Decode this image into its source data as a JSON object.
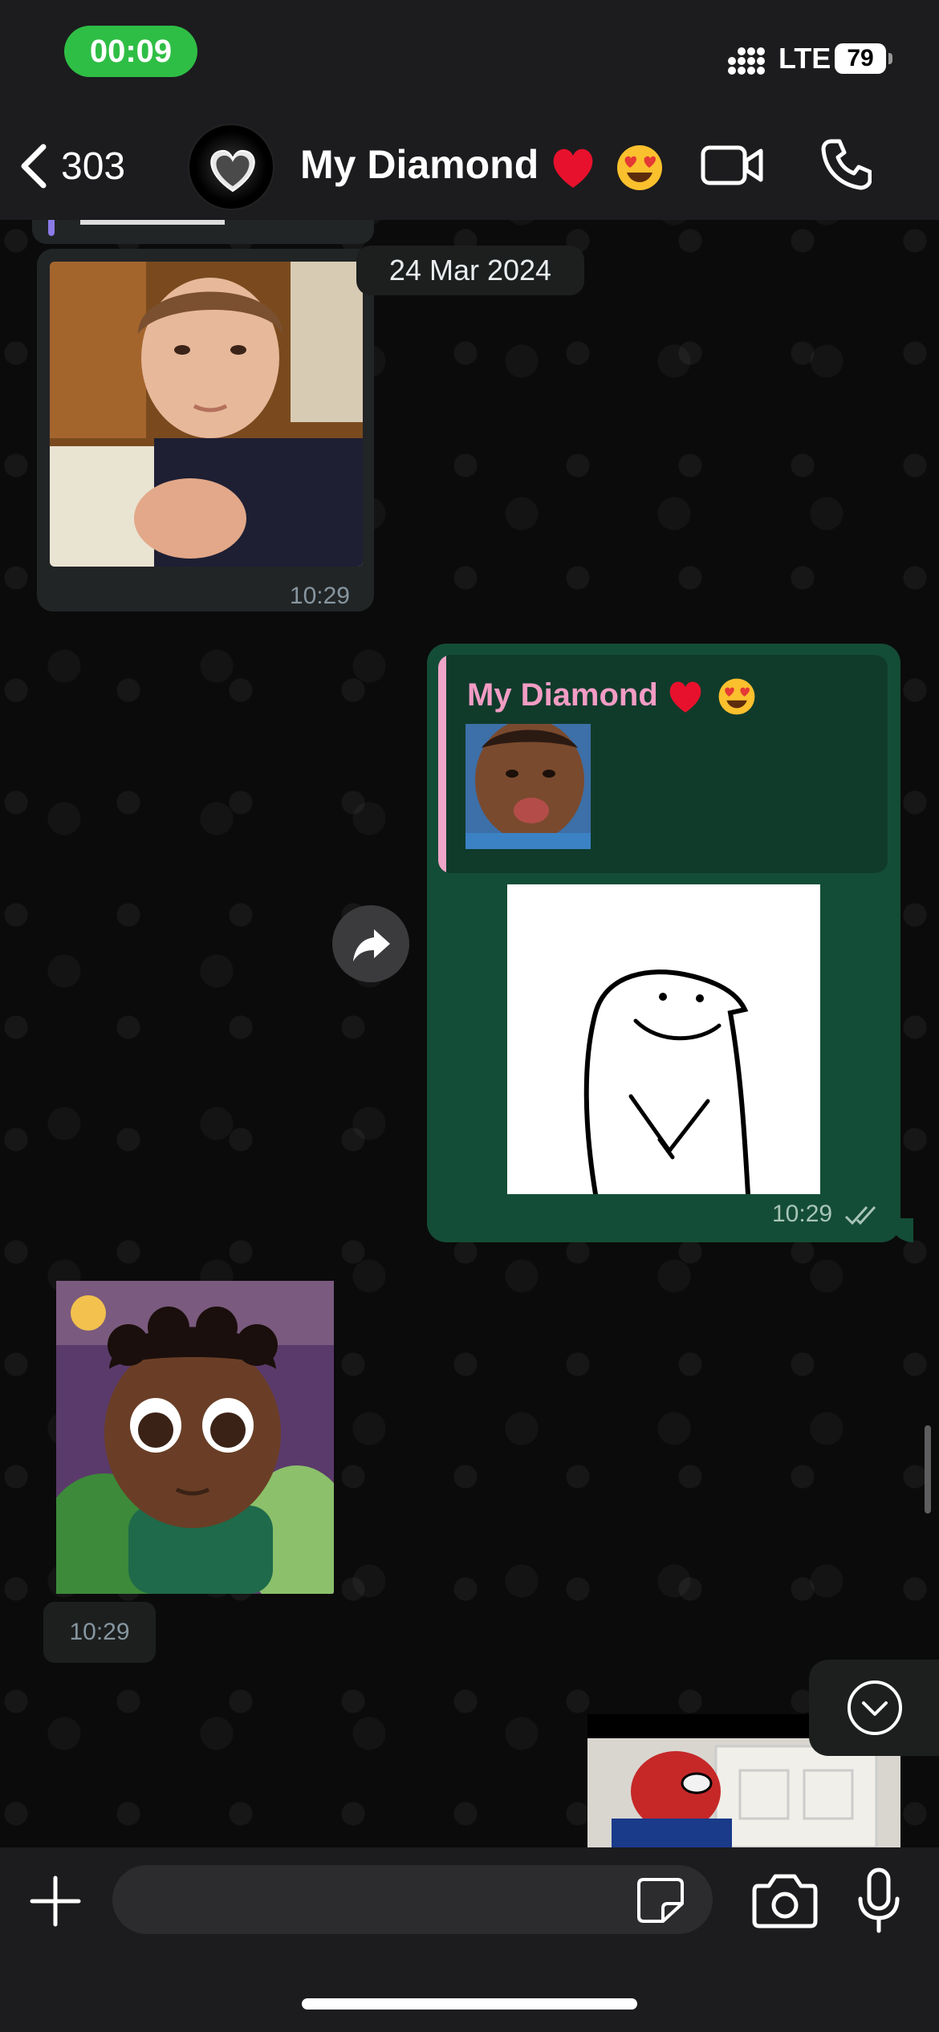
{
  "status_bar": {
    "time": "00:09",
    "network": "LTE",
    "battery": "79"
  },
  "header": {
    "back_count": "303",
    "contact_name": "My Diamond"
  },
  "messages": {
    "date_chip": "24 Mar 2024",
    "in_photo_time": "10:29",
    "out_reply_name": "My Diamond",
    "out_time": "10:29",
    "in_sticker_time": "10:29"
  },
  "composer": {
    "placeholder": ""
  },
  "colors": {
    "outgoing_bubble": "#144d37",
    "incoming_bubble": "#222526",
    "time_pill": "#2fbe45",
    "quote_name": "#f29cc4"
  },
  "icons": [
    "back-chevron-icon",
    "video-call-icon",
    "phone-icon",
    "forward-icon",
    "chevron-down-icon",
    "plus-icon",
    "sticker-icon",
    "camera-icon",
    "microphone-icon",
    "read-receipt-icon"
  ]
}
